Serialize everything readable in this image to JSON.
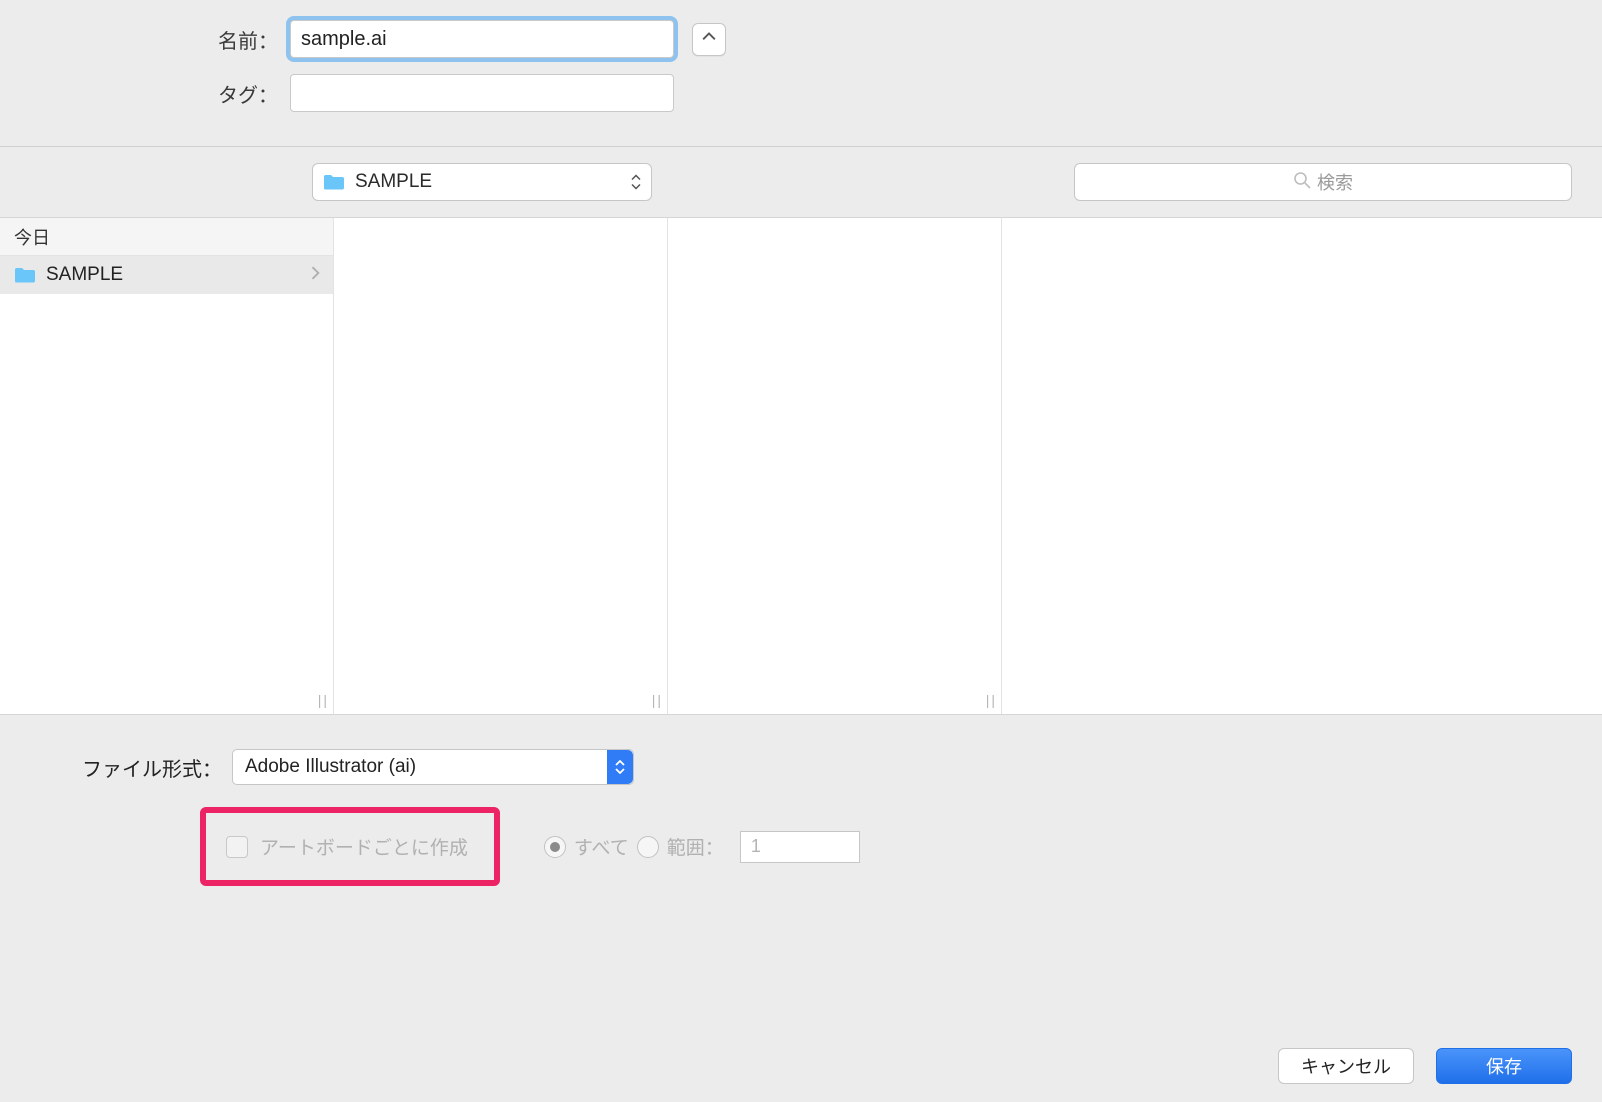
{
  "labels": {
    "name": "名前：",
    "tags": "タグ：",
    "fileformat": "ファイル形式：",
    "today": "今日"
  },
  "inputs": {
    "filename": "sample.ai",
    "tags": "",
    "range_value": "1"
  },
  "folder": {
    "name": "SAMPLE"
  },
  "search": {
    "placeholder": "検索"
  },
  "sidebar": {
    "items": [
      {
        "label": "SAMPLE"
      }
    ]
  },
  "fileformat": {
    "selected": "Adobe Illustrator (ai)"
  },
  "artboard": {
    "checkbox_label": "アートボードごとに作成",
    "all_label": "すべて",
    "range_label": "範囲："
  },
  "buttons": {
    "cancel": "キャンセル",
    "save": "保存"
  }
}
